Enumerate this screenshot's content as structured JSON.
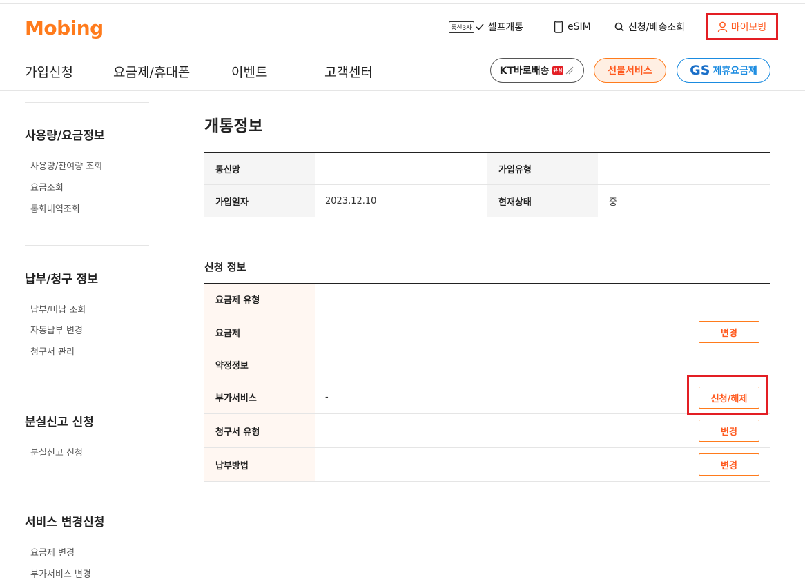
{
  "header": {
    "logo": "Mobing",
    "util": {
      "carrier_badge": "통신3사",
      "self_open": "셀프개통",
      "esim": "eSIM",
      "apply_delivery": "신청/배송조회",
      "my_mobing": "마이모빙"
    }
  },
  "gnb": {
    "items": [
      "가입신청",
      "요금제/휴대폰",
      "이벤트",
      "고객센터"
    ],
    "kt_delivery": "KT바로배송",
    "kt_tag": "유심",
    "prepaid": "선불서비스",
    "gs_logo": "GS",
    "gs_plan": "제휴요금제"
  },
  "sidebar": {
    "sections": [
      {
        "title": "사용량/요금정보",
        "links": [
          "사용량/잔여량 조회",
          "요금조회",
          "통화내역조회"
        ]
      },
      {
        "title": "납부/청구 정보",
        "links": [
          "납부/미납 조회",
          "자동납부 변경",
          "청구서 관리"
        ]
      },
      {
        "title": "분실신고 신청",
        "links": [
          "분실신고 신청"
        ]
      },
      {
        "title": "서비스 변경신청",
        "links": [
          "요금제 변경",
          "부가서비스 변경"
        ]
      }
    ]
  },
  "main": {
    "title": "개통정보",
    "open_info": {
      "network_label": "통신망",
      "network_value": "",
      "join_type_label": "가입유형",
      "join_type_value": "",
      "join_date_label": "가입일자",
      "join_date_value": "2023.12.10",
      "status_label": "현재상태",
      "status_value": "중"
    },
    "apply_info": {
      "title": "신청 정보",
      "rows": [
        {
          "label": "요금제 유형",
          "value": "",
          "button": ""
        },
        {
          "label": "요금제",
          "value": "",
          "button": "변경"
        },
        {
          "label": "약정정보",
          "value": "",
          "button": ""
        },
        {
          "label": "부가서비스",
          "value": "-",
          "button": "신청/해제"
        },
        {
          "label": "청구서 유형",
          "value": "",
          "button": "변경"
        },
        {
          "label": "납부방법",
          "value": "",
          "button": "변경"
        }
      ]
    }
  },
  "colors": {
    "brand_orange": "#ff7b1c",
    "highlight_red": "#e31e24",
    "gs_blue": "#1a8be0"
  }
}
